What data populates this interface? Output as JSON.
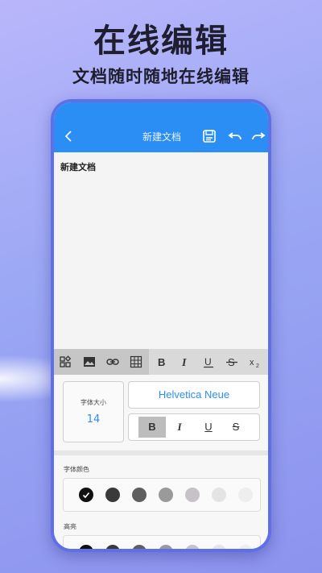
{
  "hero": {
    "title": "在线编辑",
    "subtitle": "文档随时随地在线编辑"
  },
  "app": {
    "accent": "#2b8ef5",
    "topbar": {
      "title": "新建文档",
      "icons": [
        "chevron-left-icon",
        "save-icon",
        "undo-icon",
        "redo-icon"
      ]
    },
    "document": {
      "heading": "新建文档"
    },
    "toolbar": {
      "icons": [
        "widgets-icon",
        "image-icon",
        "link-icon",
        "table-icon",
        "bold-icon",
        "italic-icon",
        "underline-icon",
        "strikethrough-icon",
        "subscript-icon"
      ]
    },
    "format_panel": {
      "font_size_label": "字体大小",
      "font_size_value": "14",
      "font_family": "Helvetica Neue",
      "style_buttons": [
        "B",
        "I",
        "U",
        "S"
      ],
      "active_style": "B",
      "font_color_label": "字体颜色",
      "highlight_label": "高亮",
      "font_colors": [
        "#111111",
        "#3a3a3a",
        "#5f5f5f",
        "#9a9a9a",
        "#c7c2c7",
        "#e4e4e4",
        "#eeeeee"
      ],
      "selected_color": "#111111",
      "highlight_colors": [
        "#111111",
        "#3a3a3a",
        "#5f5f5f",
        "#9a9a9a",
        "#c7c2c7",
        "#e4e4e4",
        "#eeeeee"
      ]
    }
  }
}
